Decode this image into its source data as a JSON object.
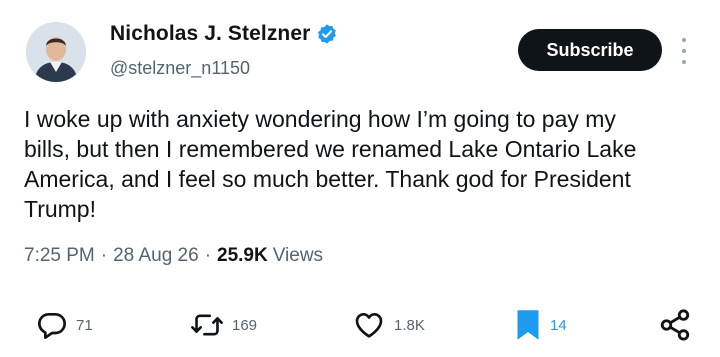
{
  "author": {
    "name": "Nicholas J. Stelzner",
    "handle": "@stelzner_n1150",
    "verified_color": "#1d9bf0"
  },
  "subscribe_label": "Subscribe",
  "tweet": {
    "lines": [
      "I woke up with anxiety wondering how I’m going to pay my",
      "bills, but then I remembered we renamed Lake Ontario Lake",
      "America, and I feel so much better. Thank god for President",
      "Trump!"
    ]
  },
  "meta": {
    "time": "7:25 PM",
    "separator": "·",
    "date": "28 Aug 26",
    "views_count": "25.9K",
    "views_label": "Views"
  },
  "actions": {
    "replies": "71",
    "reposts": "169",
    "likes": "1.8K",
    "bookmarks": "14"
  },
  "icons": {
    "reply": "reply-icon",
    "repost": "repost-icon",
    "like": "heart-icon",
    "bookmark": "bookmark-icon",
    "share": "share-icon",
    "more": "more-options-icon",
    "verified": "verified-badge-icon"
  },
  "colors": {
    "accent": "#1d9bf0",
    "text": "#0f1419",
    "muted": "#536471"
  }
}
